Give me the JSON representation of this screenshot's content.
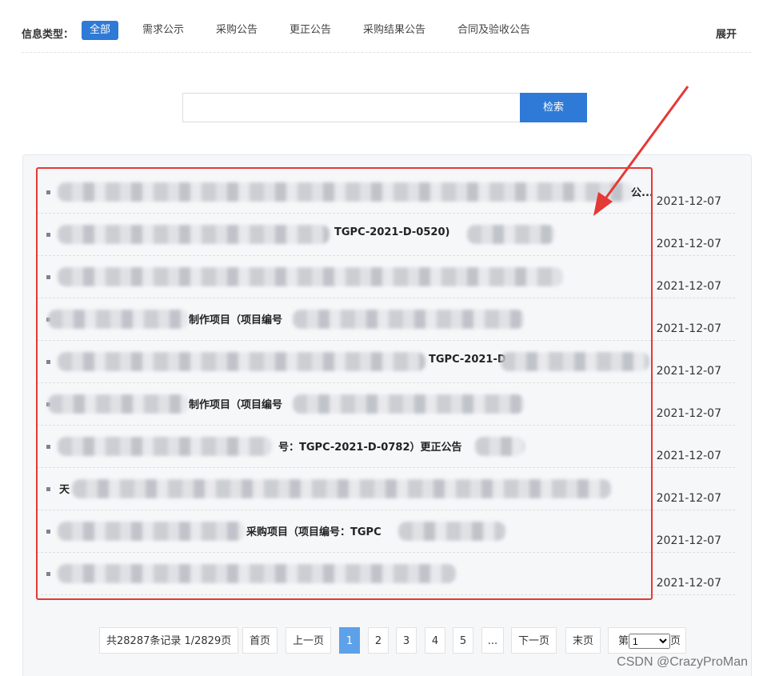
{
  "filter": {
    "label": "信息类型：",
    "options": [
      "全部",
      "需求公示",
      "采购公告",
      "更正公告",
      "采购结果公告",
      "合同及验收公告"
    ],
    "active_index": 0,
    "expand_label": "展开"
  },
  "search": {
    "value": "",
    "placeholder": "",
    "button_label": "检索"
  },
  "results": [
    {
      "title": "公...",
      "date": "2021-12-07"
    },
    {
      "title": "TGPC-2021-D-0520)",
      "date": "2021-12-07"
    },
    {
      "title": "",
      "date": "2021-12-07"
    },
    {
      "title": "制作项目（项目编号",
      "date": "2021-12-07"
    },
    {
      "title": "TGPC-2021-D",
      "date": "2021-12-07"
    },
    {
      "title": "制作项目（项目编号",
      "date": "2021-12-07"
    },
    {
      "title": "号：TGPC-2021-D-0782）更正公告",
      "date": "2021-12-07"
    },
    {
      "title": "天",
      "date": "2021-12-07"
    },
    {
      "title": "采购项目（项目编号：TGPC",
      "date": "2021-12-07"
    },
    {
      "title": "",
      "date": "2021-12-07"
    }
  ],
  "pagination": {
    "summary": "共28287条记录 1/2829页",
    "first": "首页",
    "prev": "上一页",
    "pages": [
      "1",
      "2",
      "3",
      "4",
      "5",
      "..."
    ],
    "current": "1",
    "next": "下一页",
    "last": "末页",
    "jump_prefix": "第",
    "jump_value": "1",
    "jump_suffix": "页"
  },
  "watermark": "CSDN @CrazyProMan",
  "colors": {
    "accent": "#2e7ad6",
    "annotation": "#e53935",
    "active_page": "#5da1e8"
  }
}
